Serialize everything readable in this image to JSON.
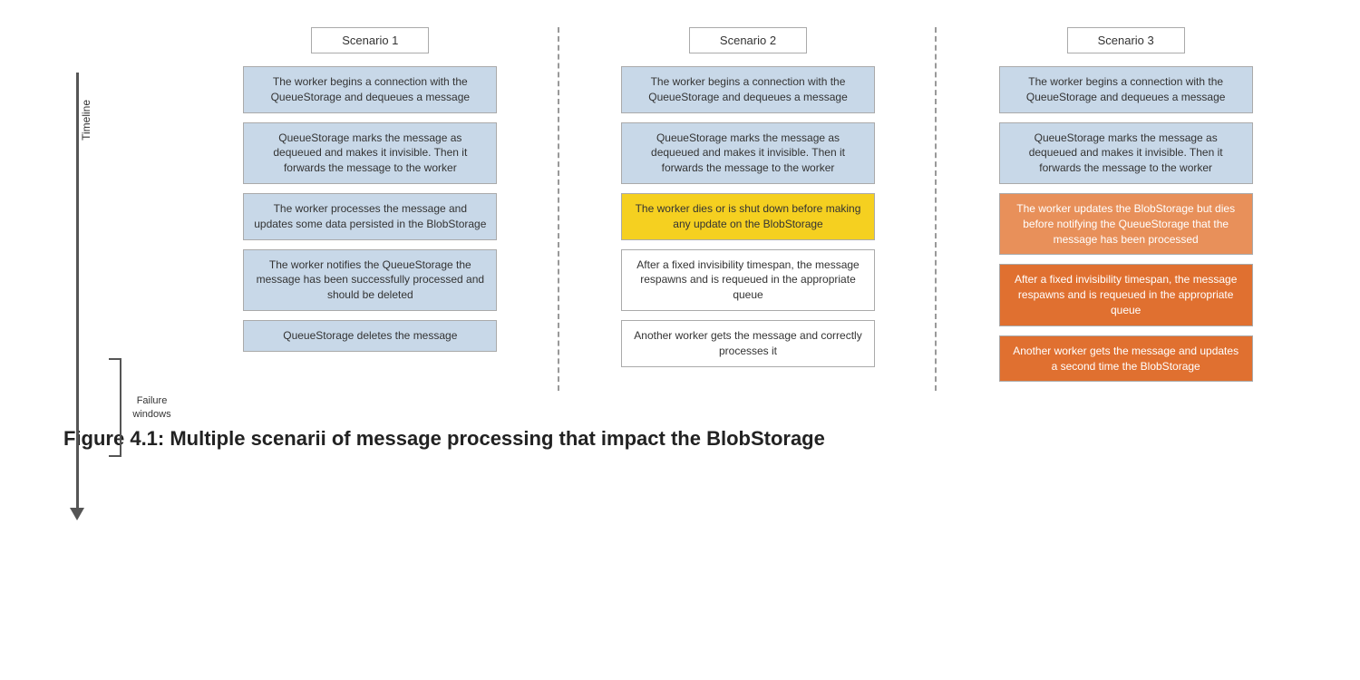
{
  "timeline": {
    "label": "Timeline"
  },
  "failure_windows": {
    "label": "Failure\nwindows"
  },
  "scenarios": [
    {
      "id": "scenario-1",
      "title": "Scenario 1",
      "boxes": [
        {
          "id": "s1-box1",
          "text": "The worker begins a connection with the QueueStorage and dequeues a message",
          "style": "light-blue"
        },
        {
          "id": "s1-box2",
          "text": "QueueStorage marks the message as dequeued and makes it invisible. Then it forwards the message to the worker",
          "style": "light-blue"
        },
        {
          "id": "s1-box3",
          "text": "The worker processes the message and updates some data persisted in the BlobStorage",
          "style": "light-blue"
        },
        {
          "id": "s1-box4",
          "text": "The worker notifies the QueueStorage the message has been successfully processed and should be deleted",
          "style": "light-blue"
        },
        {
          "id": "s1-box5",
          "text": "QueueStorage deletes the message",
          "style": "light-blue"
        }
      ]
    },
    {
      "id": "scenario-2",
      "title": "Scenario 2",
      "boxes": [
        {
          "id": "s2-box1",
          "text": "The worker begins a connection with the QueueStorage and dequeues a message",
          "style": "light-blue"
        },
        {
          "id": "s2-box2",
          "text": "QueueStorage marks the message as dequeued and makes it invisible. Then it forwards the message to the worker",
          "style": "light-blue"
        },
        {
          "id": "s2-box3",
          "text": "The worker dies or is shut down before making any update on the BlobStorage",
          "style": "yellow"
        },
        {
          "id": "s2-box4",
          "text": "After a fixed invisibility timespan, the message respawns and is requeued in the appropriate queue",
          "style": "white"
        },
        {
          "id": "s2-box5",
          "text": "Another worker gets the message and correctly processes it",
          "style": "white"
        }
      ]
    },
    {
      "id": "scenario-3",
      "title": "Scenario 3",
      "boxes": [
        {
          "id": "s3-box1",
          "text": "The worker begins a connection with the QueueStorage and dequeues a message",
          "style": "light-blue"
        },
        {
          "id": "s3-box2",
          "text": "QueueStorage marks the message as dequeued and makes it invisible. Then it forwards the message to the worker",
          "style": "light-blue"
        },
        {
          "id": "s3-box3",
          "text": "The worker updates the BlobStorage but dies before notifying the QueueStorage that the message has been processed",
          "style": "orange-light"
        },
        {
          "id": "s3-box4",
          "text": "After a fixed invisibility timespan, the message respawns and is requeued in the appropriate queue",
          "style": "orange-medium"
        },
        {
          "id": "s3-box5",
          "text": "Another worker gets the message and updates a second time the BlobStorage",
          "style": "orange-medium"
        }
      ]
    }
  ],
  "figure_caption": "Figure 4.1: Multiple scenarii of message processing that impact the BlobStorage"
}
